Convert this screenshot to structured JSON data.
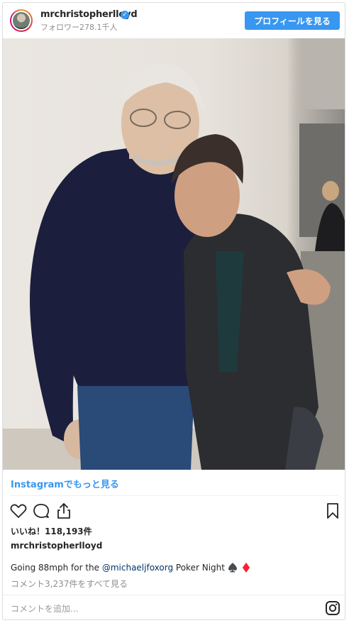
{
  "header": {
    "username": "mrchristopherlloyd",
    "verified_mark": "✓",
    "followers": "フォロワー278.1千人",
    "profile_button": "プロフィールを見る"
  },
  "post": {
    "view_on_instagram": "Instagramでもっと見る",
    "likes": "いいね！118,193件",
    "poster": "mrchristopherlloyd",
    "caption_prefix": "Going 88mph for the ",
    "caption_mention": "@michaeljfoxorg",
    "caption_suffix": " Poker Night ♠️ ♦️",
    "view_comments": "コメント3,237件をすべて見る",
    "comment_placeholder": "コメントを追加..."
  },
  "icons": {
    "like": "heart-icon",
    "comment": "comment-icon",
    "share": "share-icon",
    "save": "bookmark-icon",
    "brand": "instagram-icon"
  },
  "colors": {
    "accent": "#3897f0",
    "text": "#262626",
    "muted": "#8e8e8e",
    "border": "#dbdbdb"
  }
}
